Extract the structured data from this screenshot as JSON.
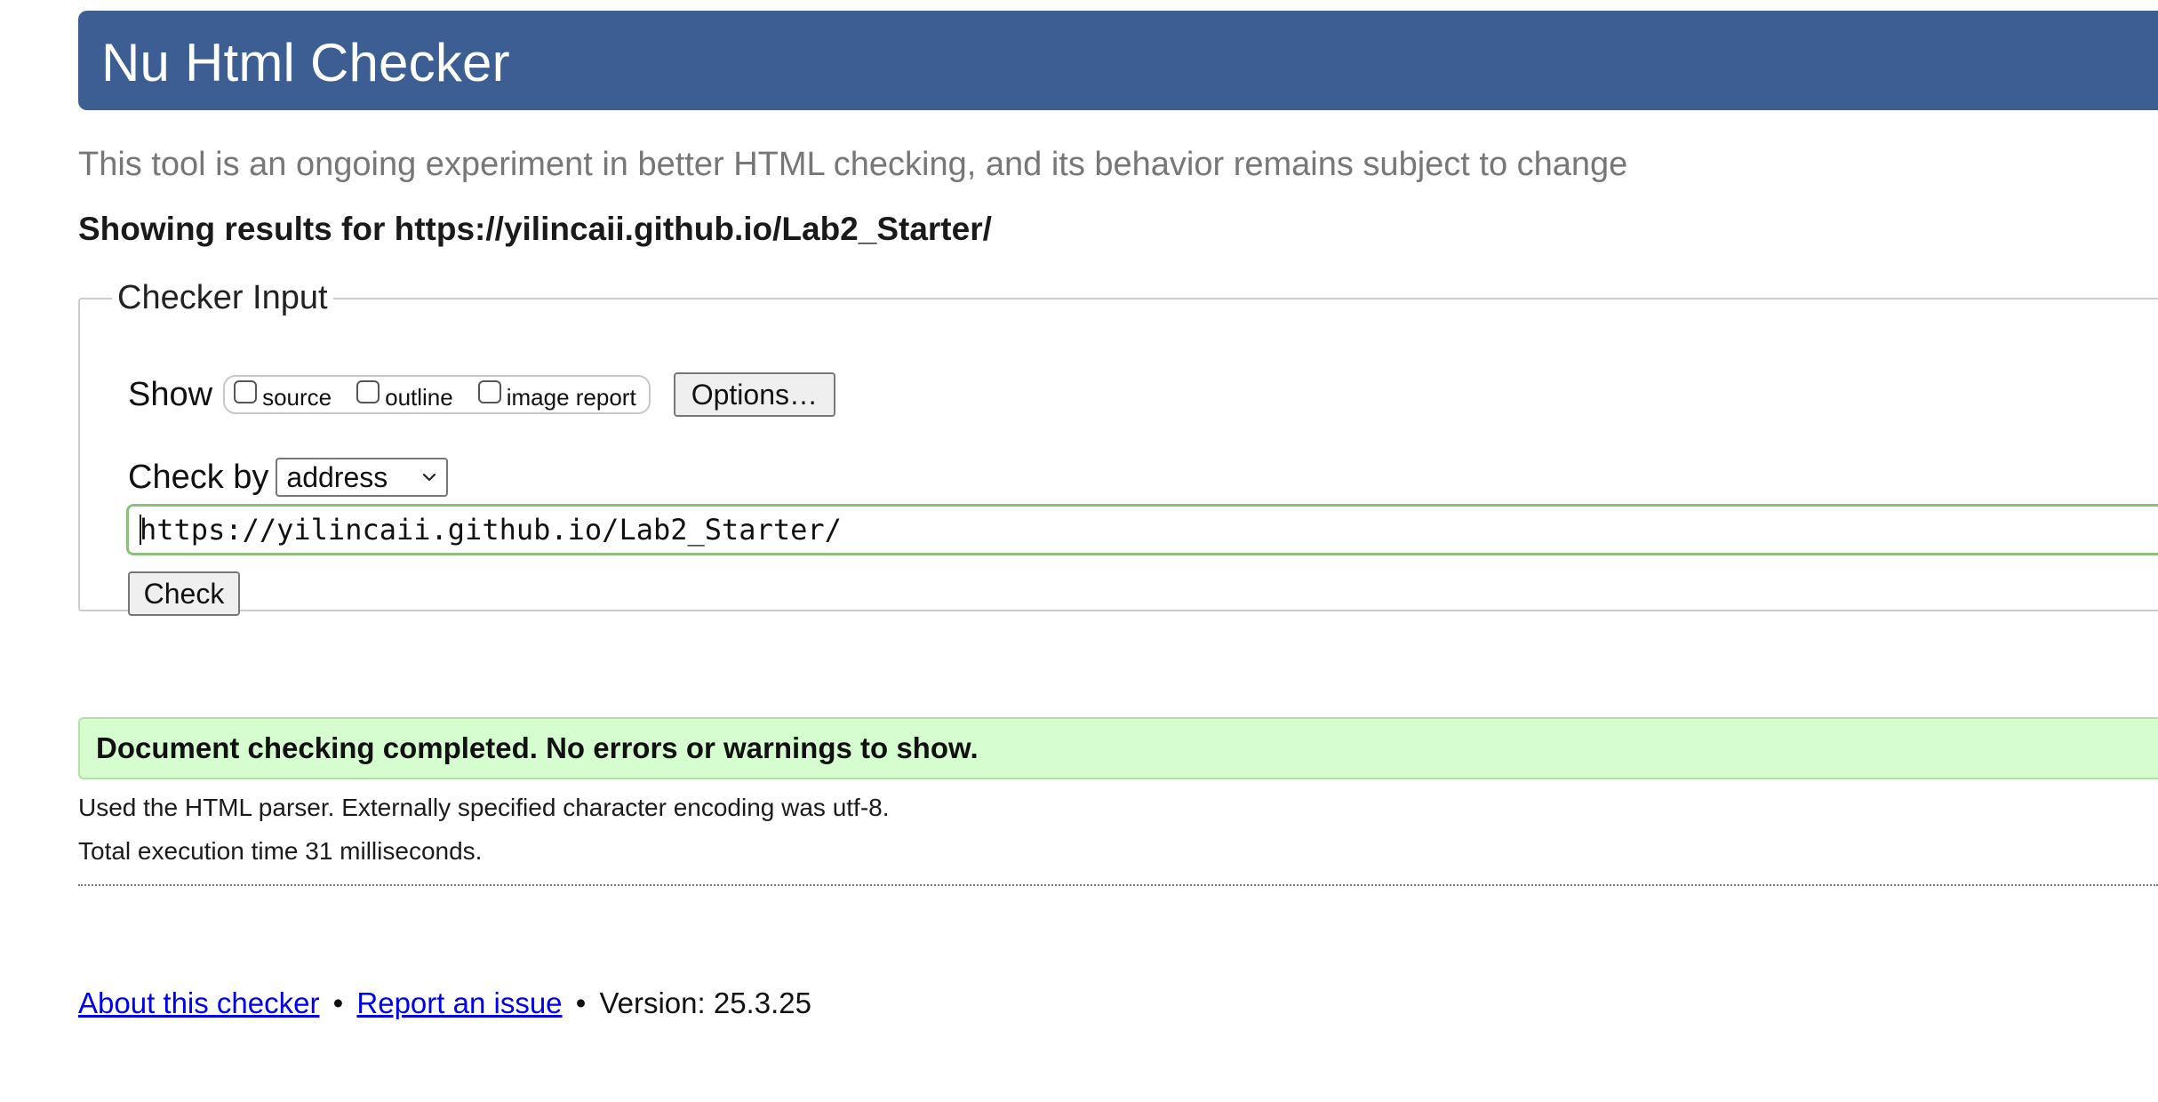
{
  "header": {
    "title": "Nu Html Checker"
  },
  "subtitle": "This tool is an ongoing experiment in better HTML checking, and its behavior remains subject to change",
  "results_heading": "Showing results for https://yilincaii.github.io/Lab2_Starter/",
  "checker_input": {
    "legend": "Checker Input",
    "show_label": "Show",
    "show_options": [
      {
        "label": "source",
        "checked": false
      },
      {
        "label": "outline",
        "checked": false
      },
      {
        "label": "image report",
        "checked": false
      }
    ],
    "options_button": "Options…",
    "check_by_label": "Check by",
    "check_by_value": "address",
    "url_value": "https://yilincaii.github.io/Lab2_Starter/",
    "check_button": "Check"
  },
  "result": {
    "success_message": "Document checking completed. No errors or warnings to show.",
    "parser_info": "Used the HTML parser. Externally specified character encoding was utf-8.",
    "execution_time": "Total execution time 31 milliseconds."
  },
  "footer": {
    "about_link": "About this checker",
    "separator": "•",
    "report_link": "Report an issue",
    "version_text": "Version: 25.3.25"
  },
  "colors": {
    "header_bg": "#3c5e93",
    "success_bg": "#d5fdd0",
    "input_focus_border": "#8dc07c",
    "link": "#0000ee"
  }
}
